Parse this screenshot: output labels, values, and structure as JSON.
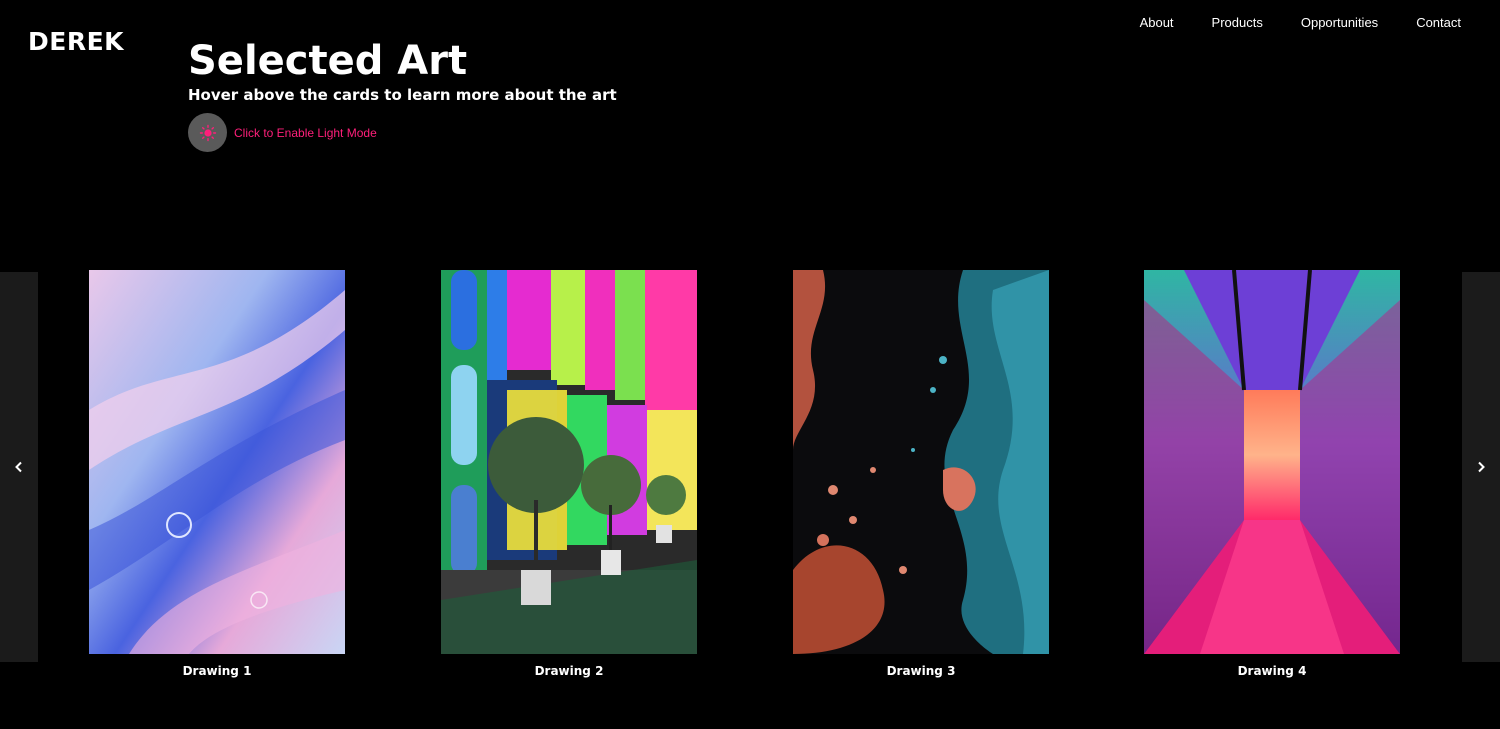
{
  "brand": "DEREK",
  "nav": {
    "items": [
      {
        "label": "About"
      },
      {
        "label": "Products"
      },
      {
        "label": "Opportunities"
      },
      {
        "label": "Contact"
      }
    ]
  },
  "header": {
    "title": "Selected Art",
    "subtitle": "Hover above the cards to learn more about the art",
    "mode_label": "Click to Enable Light Mode",
    "mode_icon": "sun-icon",
    "accent_color": "#ff1f7a"
  },
  "carousel": {
    "prev_icon": "chevron-left-icon",
    "next_icon": "chevron-right-icon",
    "cards": [
      {
        "label": "Drawing 1"
      },
      {
        "label": "Drawing 2"
      },
      {
        "label": "Drawing 3"
      },
      {
        "label": "Drawing 4"
      }
    ]
  }
}
